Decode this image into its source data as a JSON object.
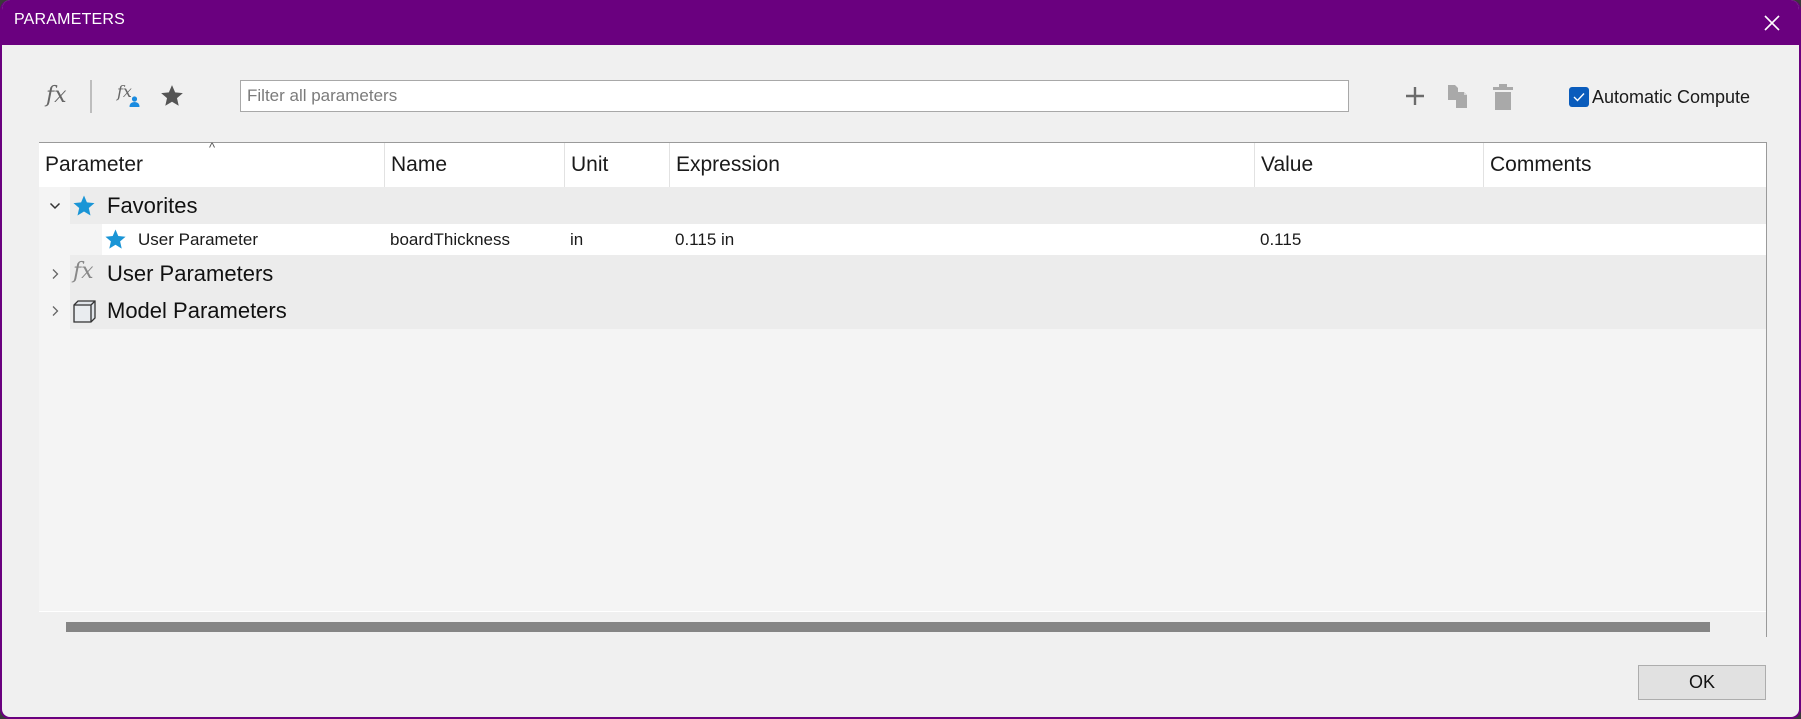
{
  "window": {
    "title": "PARAMETERS",
    "accent_color": "#6a007f"
  },
  "toolbar": {
    "icons": {
      "fx": "fx",
      "fx_user": "fx"
    },
    "filter": {
      "placeholder": "Filter all parameters",
      "value": ""
    },
    "auto_compute": {
      "label": "Automatic Compute",
      "checked": true
    }
  },
  "table": {
    "columns": [
      "Parameter",
      "Name",
      "Unit",
      "Expression",
      "Value",
      "Comments"
    ],
    "sort_indicator": "^",
    "groups": [
      {
        "label": "Favorites",
        "icon": "star-icon",
        "expanded": true,
        "rows": [
          {
            "parameter": "User Parameter",
            "name": "boardThickness",
            "unit": "in",
            "expression": "0.115 in",
            "value": "0.115",
            "comments": ""
          }
        ]
      },
      {
        "label": "User Parameters",
        "icon": "fx-icon",
        "expanded": false,
        "rows": []
      },
      {
        "label": "Model Parameters",
        "icon": "model-box-icon",
        "expanded": false,
        "rows": []
      }
    ]
  },
  "footer": {
    "ok_label": "OK"
  }
}
